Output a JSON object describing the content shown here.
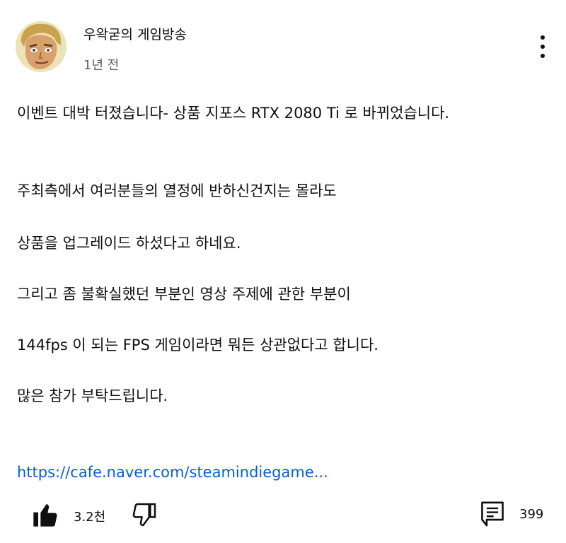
{
  "channel": {
    "name": "우왁굳의 게임방송",
    "time": "1년 전",
    "avatar_icon": "cartoon-face-avatar"
  },
  "post": {
    "lines": [
      "이벤트 대박 터졌습니다- 상품 지포스 RTX 2080 Ti 로 바뀌었습니다.",
      "주최측에서 여러분들의 열정에 반하신건지는 몰라도",
      "상품을 업그레이드 하셨다고 하네요.",
      "그리고 좀 불확실했던 부분인 영상 주제에 관한 부분이",
      "144fps 이 되는 FPS 게임이라면 뭐든 상관없다고 합니다.",
      "많은 참가 부탁드립니다."
    ],
    "link": "https://cafe.naver.com/steamindiegame..."
  },
  "actions": {
    "like_count": "3.2천",
    "comment_count": "399",
    "like_icon": "thumbs-up-filled-icon",
    "dislike_icon": "thumbs-down-outline-icon",
    "comment_icon": "comment-icon",
    "more_icon": "more-vertical-icon"
  },
  "colors": {
    "text": "#0f0f0f",
    "secondary_text": "#606060",
    "link": "#065fd4",
    "background": "#ffffff"
  }
}
